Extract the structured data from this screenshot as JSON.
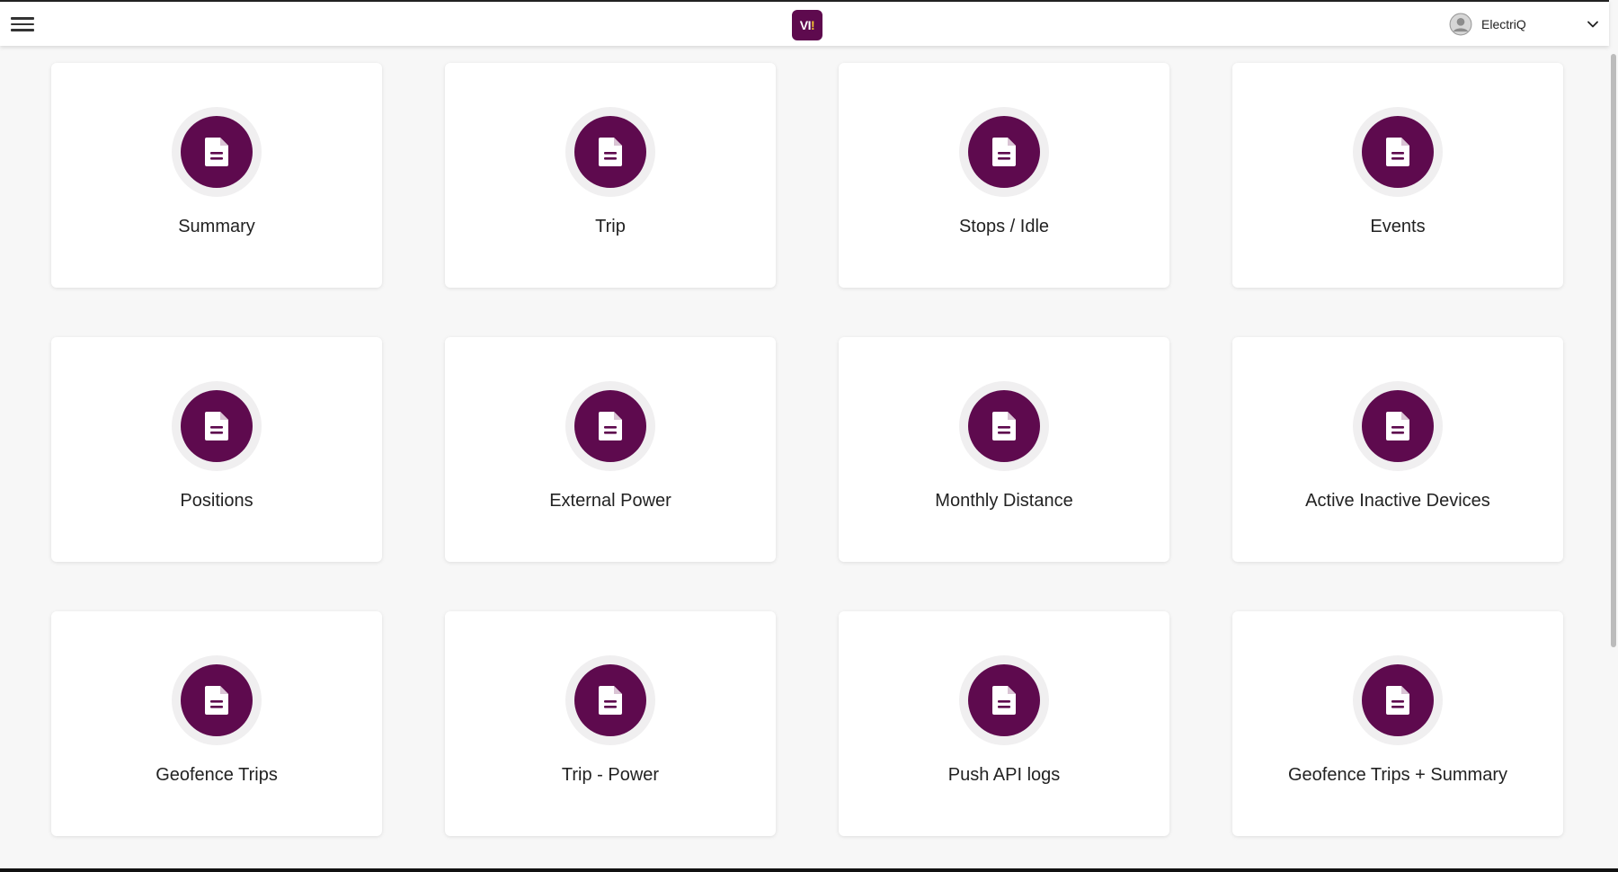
{
  "header": {
    "menu_icon": "hamburger-icon",
    "logo_text": "VI",
    "logo_accent": "!",
    "user_name": "ElectriQ",
    "user_icon": "user-circle-icon",
    "dropdown_icon": "chevron-down-icon"
  },
  "colors": {
    "brand": "#5e0a4e",
    "card_bg": "#ffffff",
    "page_bg": "#f7f7f7"
  },
  "reports": [
    {
      "label": "Summary",
      "icon": "document-icon"
    },
    {
      "label": "Trip",
      "icon": "document-icon"
    },
    {
      "label": "Stops / Idle",
      "icon": "document-icon"
    },
    {
      "label": "Events",
      "icon": "document-icon"
    },
    {
      "label": "Positions",
      "icon": "document-icon"
    },
    {
      "label": "External Power",
      "icon": "document-icon"
    },
    {
      "label": "Monthly Distance",
      "icon": "document-icon"
    },
    {
      "label": "Active Inactive Devices",
      "icon": "document-icon"
    },
    {
      "label": "Geofence Trips",
      "icon": "document-icon"
    },
    {
      "label": "Trip - Power",
      "icon": "document-icon"
    },
    {
      "label": "Push API logs",
      "icon": "document-icon"
    },
    {
      "label": "Geofence Trips + Summary",
      "icon": "document-icon"
    }
  ]
}
